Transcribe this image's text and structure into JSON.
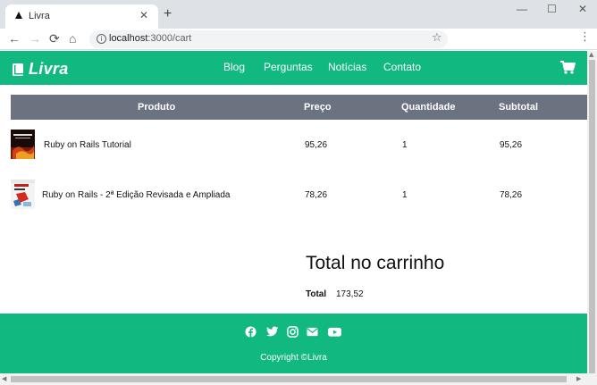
{
  "browser": {
    "tab_title": "Livra",
    "tab_close": "✕",
    "new_tab": "+",
    "url_host": "localhost",
    "url_path": ":3000/cart",
    "controls": {
      "minimize": "—",
      "maximize": "☐",
      "close": "✕"
    },
    "nav": {
      "back": "←",
      "forward": "→",
      "reload": "⟳",
      "home": "⌂"
    },
    "star": "☆",
    "menu": "⋮"
  },
  "header": {
    "logo_text": "Livra",
    "accent_color": "#11b981",
    "nav": [
      "Blog",
      "Perguntas",
      "Notícias",
      "Contato"
    ]
  },
  "table": {
    "headers": [
      "Produto",
      "Preço",
      "Quantidade",
      "Subtotal"
    ],
    "header_bg": "#6b7280",
    "rows": [
      {
        "name": "Ruby on Rails Tutorial",
        "price": "95,26",
        "quantity": "1",
        "subtotal": "95,26"
      },
      {
        "name": "Ruby on Rails - 2ª Edição Revisada e Ampliada",
        "price": "78,26",
        "quantity": "1",
        "subtotal": "78,26"
      }
    ]
  },
  "summary": {
    "title": "Total no carrinho",
    "label": "Total",
    "value": "173,52"
  },
  "footer": {
    "social_icons": [
      "facebook-icon",
      "twitter-icon",
      "instagram-icon",
      "email-icon",
      "youtube-icon"
    ],
    "copyright": "Copyright ©Livra"
  }
}
